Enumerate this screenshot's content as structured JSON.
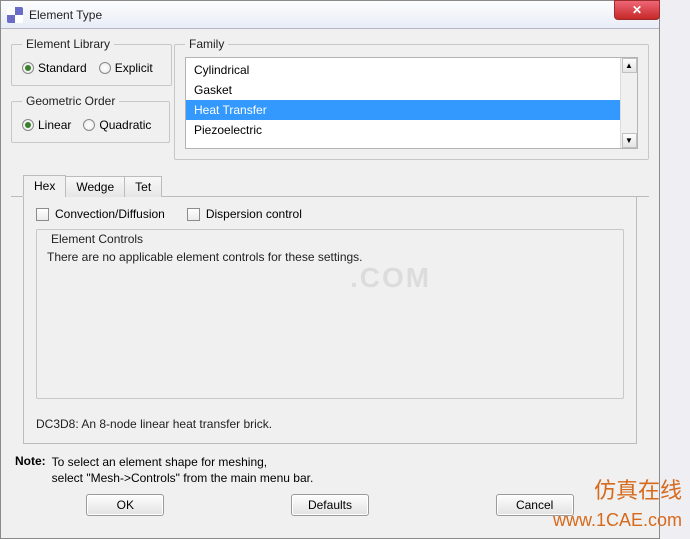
{
  "window": {
    "title": "Element Type"
  },
  "library": {
    "legend": "Element Library",
    "options": [
      "Standard",
      "Explicit"
    ],
    "selected": "Standard"
  },
  "order": {
    "legend": "Geometric Order",
    "options": [
      "Linear",
      "Quadratic"
    ],
    "selected": "Linear"
  },
  "family": {
    "legend": "Family",
    "items": [
      "Cylindrical",
      "Gasket",
      "Heat Transfer",
      "Piezoelectric"
    ],
    "selected": "Heat Transfer"
  },
  "tabs": {
    "items": [
      "Hex",
      "Wedge",
      "Tet"
    ],
    "active": "Hex"
  },
  "checks": {
    "convection": "Convection/Diffusion",
    "dispersion": "Dispersion control"
  },
  "controls": {
    "legend": "Element Controls",
    "text": "There are no applicable element controls for these settings."
  },
  "description": "DC3D8:  An 8-node linear heat transfer brick.",
  "note": {
    "label": "Note:",
    "line1": "To select an element shape for meshing,",
    "line2": "select \"Mesh->Controls\" from the main menu bar."
  },
  "buttons": {
    "ok": "OK",
    "defaults": "Defaults",
    "cancel": "Cancel"
  },
  "watermarks": {
    "big": ".COM",
    "cn": "仿真在线",
    "url": "www.1CAE.com"
  }
}
